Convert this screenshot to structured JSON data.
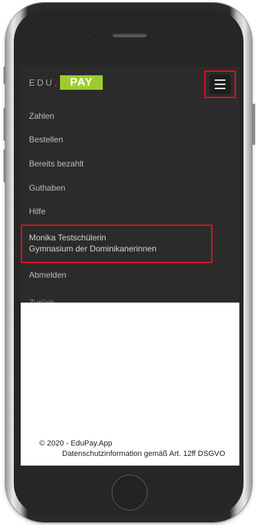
{
  "brand": {
    "edu": "EDU",
    "dot": ".",
    "pay": "PAY"
  },
  "navbar": {
    "toggler_icon": "hamburger-menu-icon"
  },
  "menu": {
    "items": [
      {
        "label": "Zahlen"
      },
      {
        "label": "Bestellen"
      },
      {
        "label": "Bereits bezahlt"
      },
      {
        "label": "Guthaben"
      },
      {
        "label": "Hilfe"
      }
    ],
    "user": {
      "name": "Monika Testschülerin",
      "school": "Gymnasium der Dominikanerinnen"
    },
    "logout": "Abmelden",
    "partial": "Zurück"
  },
  "footer": {
    "copyright": "© 2020 - EduPay.App",
    "privacy": "Datenschutzinformation gemäß Art. 12ff DSGVO"
  },
  "colors": {
    "accent": "#9ccd2f",
    "highlight": "#e0101a",
    "navbar": "#2b2b2b"
  }
}
